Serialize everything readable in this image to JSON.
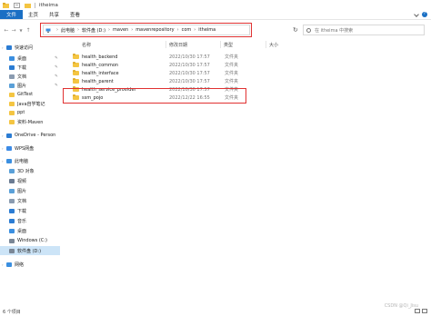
{
  "window": {
    "title": "itheima"
  },
  "ribbon": {
    "tabs": [
      "文件",
      "主页",
      "共享",
      "查看"
    ]
  },
  "address": {
    "crumbs": [
      "此电脑",
      "软件盘 (D:)",
      "maven",
      "mavenrepository",
      "com",
      "itheima"
    ]
  },
  "search": {
    "placeholder": "在 itheima 中搜索"
  },
  "columns": {
    "name": "名称",
    "date": "修改日期",
    "type": "类型",
    "size": "大小"
  },
  "files": [
    {
      "name": "health_backend",
      "date": "2022/10/30 17:57",
      "type": "文件夹"
    },
    {
      "name": "health_common",
      "date": "2022/10/30 17:57",
      "type": "文件夹"
    },
    {
      "name": "health_interface",
      "date": "2022/10/30 17:57",
      "type": "文件夹"
    },
    {
      "name": "health_parent",
      "date": "2022/10/30 17:57",
      "type": "文件夹"
    },
    {
      "name": "health_service_provider",
      "date": "2022/10/30 17:57",
      "type": "文件夹"
    },
    {
      "name": "ssm_pojo",
      "date": "2022/12/22 16:55",
      "type": "文件夹"
    }
  ],
  "nav": [
    {
      "label": "快速访问",
      "icon": "star-icon",
      "color": "#2b7cd3"
    },
    {
      "label": "桌面",
      "icon": "desktop-icon",
      "color": "#3b8fe0",
      "pinned": true
    },
    {
      "label": "下载",
      "icon": "download-icon",
      "color": "#2b7cd3",
      "pinned": true
    },
    {
      "label": "文档",
      "icon": "document-icon",
      "color": "#8a9bb0",
      "pinned": true
    },
    {
      "label": "图片",
      "icon": "picture-icon",
      "color": "#5aa0d8",
      "pinned": true
    },
    {
      "label": "GitTest",
      "icon": "folder-icon",
      "color": "#f4c542"
    },
    {
      "label": "Java自学笔记",
      "icon": "folder-icon",
      "color": "#f4c542"
    },
    {
      "label": "ppt",
      "icon": "folder-icon",
      "color": "#f4c542"
    },
    {
      "label": "资料-Maven",
      "icon": "folder-icon",
      "color": "#f4c542"
    },
    {
      "label": "OneDrive - Person",
      "icon": "cloud-icon",
      "color": "#2b7cd3"
    },
    {
      "label": "WPS网盘",
      "icon": "cloud-icon",
      "color": "#3c8be6"
    },
    {
      "label": "此电脑",
      "icon": "computer-icon",
      "color": "#3b8fe0"
    },
    {
      "label": "3D 对象",
      "icon": "cube-icon",
      "color": "#5aa0d8"
    },
    {
      "label": "视频",
      "icon": "video-icon",
      "color": "#6a7b92"
    },
    {
      "label": "图片",
      "icon": "picture-icon",
      "color": "#5aa0d8"
    },
    {
      "label": "文档",
      "icon": "document-icon",
      "color": "#8a9bb0"
    },
    {
      "label": "下载",
      "icon": "download-icon",
      "color": "#2b7cd3"
    },
    {
      "label": "音乐",
      "icon": "music-icon",
      "color": "#2b7cd3"
    },
    {
      "label": "桌面",
      "icon": "desktop-icon",
      "color": "#3b8fe0"
    },
    {
      "label": "Windows (C:)",
      "icon": "drive-icon",
      "color": "#7a8796"
    },
    {
      "label": "软件盘 (D:)",
      "icon": "drive-icon",
      "color": "#7a8796",
      "selected": true
    },
    {
      "label": "网络",
      "icon": "network-icon",
      "color": "#3b8fe0"
    }
  ],
  "status": {
    "count": "6 个项目"
  },
  "watermark": "CSDN @Qi_Jisu"
}
